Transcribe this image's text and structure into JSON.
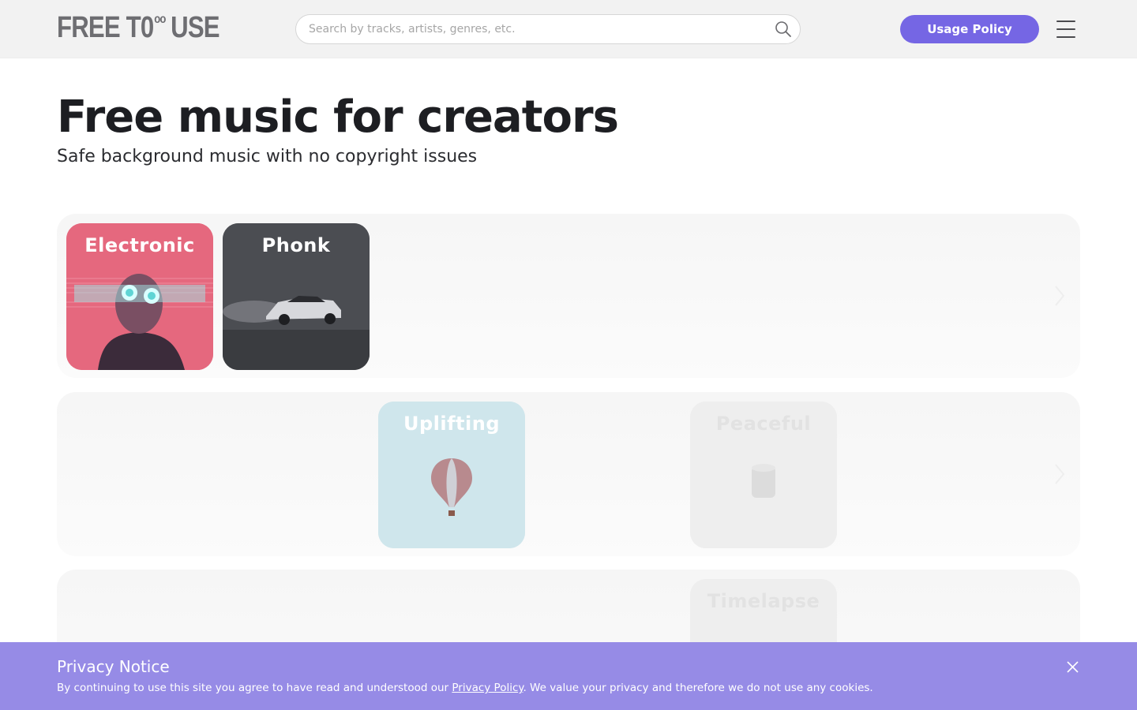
{
  "header": {
    "logo": {
      "part1": "FREE T",
      "zero": "0",
      "infinity": "oo",
      "part2": "USE"
    },
    "search": {
      "placeholder": "Search by tracks, artists, genres, etc.",
      "value": ""
    },
    "usage_policy_label": "Usage Policy",
    "icons": {
      "search": "search-icon",
      "menu": "hamburger-menu-icon"
    }
  },
  "hero": {
    "title": "Free music for creators",
    "subtitle": "Safe background music with no copyright issues"
  },
  "rows": [
    {
      "cards": [
        {
          "label": "Electronic"
        },
        {
          "label": "Phonk"
        }
      ],
      "arrow_icon": "chevron-right-icon"
    },
    {
      "cards": [
        {
          "label": "Uplifting"
        },
        {
          "label": "Peaceful"
        }
      ],
      "arrow_icon": "chevron-right-icon"
    },
    {
      "cards": [
        {
          "label": "Timelapse"
        }
      ]
    }
  ],
  "privacy": {
    "title": "Privacy Notice",
    "text_before": "By continuing to use this site you agree to have read and understood our ",
    "link": "Privacy Policy",
    "text_after": ". We value your privacy and therefore we do not use any cookies.",
    "close_icon": "close-icon"
  },
  "colors": {
    "accent": "#7566e4",
    "privacy_bar": "#968be6",
    "header_bg": "#f2f2f2"
  }
}
